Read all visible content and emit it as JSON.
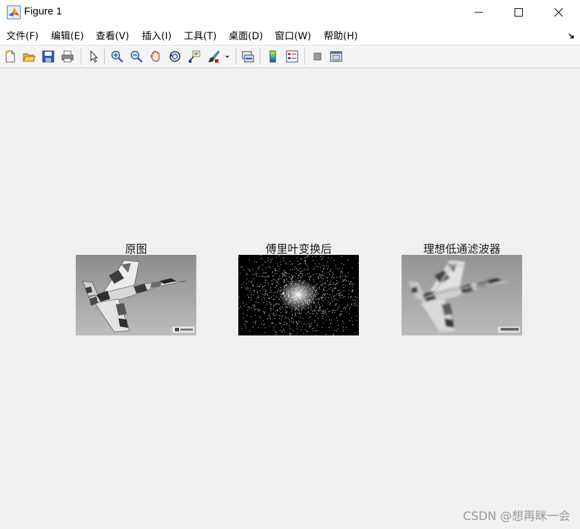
{
  "window": {
    "title": "Figure 1",
    "controls": {
      "minimize": "minimize",
      "maximize": "maximize",
      "close": "close"
    }
  },
  "menubar": {
    "items": [
      {
        "label": "文件(F)"
      },
      {
        "label": "编辑(E)"
      },
      {
        "label": "查看(V)"
      },
      {
        "label": "插入(I)"
      },
      {
        "label": "工具(T)"
      },
      {
        "label": "桌面(D)"
      },
      {
        "label": "窗口(W)"
      },
      {
        "label": "帮助(H)"
      }
    ]
  },
  "toolbar": {
    "buttons": [
      "new-figure-icon",
      "open-file-icon",
      "save-icon",
      "print-icon",
      "pointer-icon",
      "zoom-in-icon",
      "zoom-out-icon",
      "pan-hand-icon",
      "rotate-3d-icon",
      "data-cursor-icon",
      "brush-icon",
      "dropdown-arrow-icon",
      "link-plot-icon",
      "colorbar-icon",
      "legend-icon",
      "hide-plot-tools-icon",
      "show-plot-tools-icon"
    ]
  },
  "axes": [
    {
      "title": "原图",
      "image": "original-jet-image"
    },
    {
      "title": "傅里叶变换后",
      "image": "fourier-spectrum-image"
    },
    {
      "title": "理想低通滤波器",
      "image": "lowpass-filtered-jet-image"
    }
  ],
  "watermark": "CSDN @想再眯一会",
  "colors": {
    "titlebar": "#ffffff",
    "figure_background": "#f0f0f0",
    "watermark": "#9a9a9a"
  }
}
